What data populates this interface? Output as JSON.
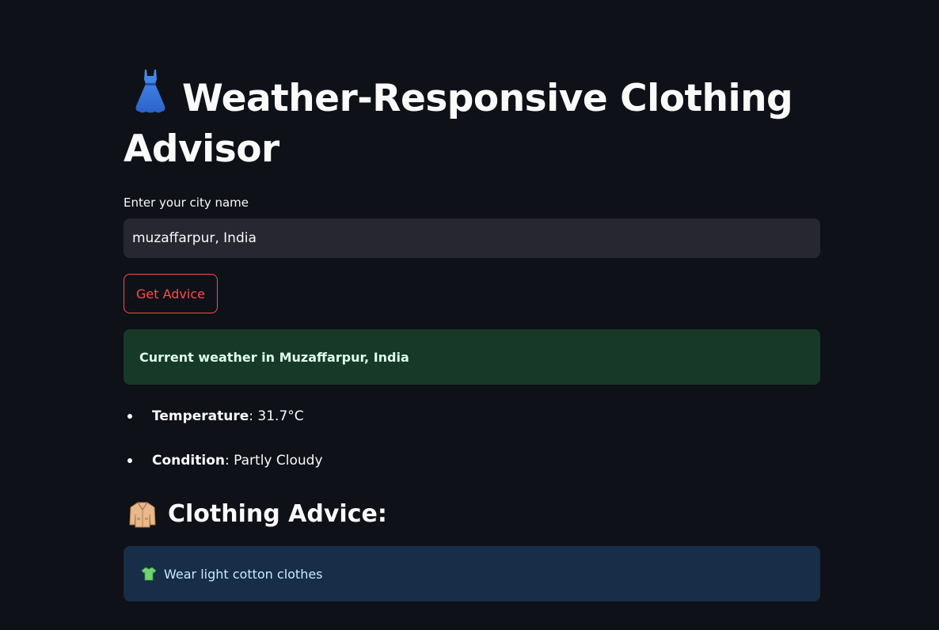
{
  "app": {
    "title": "Weather-Responsive Clothing Advisor"
  },
  "form": {
    "city_label": "Enter your city name",
    "city_value": "muzaffarpur, India",
    "button_label": "Get Advice"
  },
  "result": {
    "weather_heading": "Current weather in Muzaffarpur, India",
    "temperature_label": "Temperature",
    "temperature_value": ": 31.7°C",
    "condition_label": "Condition",
    "condition_value": ": Partly Cloudy",
    "advice_heading": "Clothing Advice:",
    "advice_text": "Wear light cotton clothes"
  },
  "icons": {
    "title": "dress-icon",
    "advice": "coat-icon",
    "advice_item": "t-shirt-icon"
  },
  "colors": {
    "background": "#0e1117",
    "accent": "#ff4b4b",
    "success_bg": "#173928",
    "info_bg": "#172d48"
  }
}
